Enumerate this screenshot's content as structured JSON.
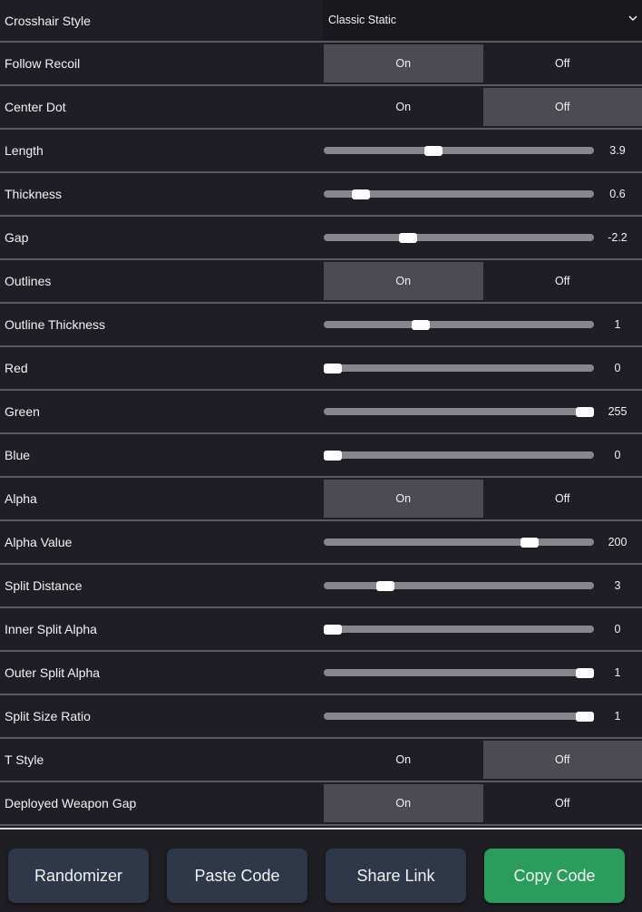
{
  "settings": [
    {
      "label": "Crosshair Style",
      "type": "select",
      "value": "Classic Static"
    },
    {
      "label": "Follow Recoil",
      "type": "toggle",
      "on_label": "On",
      "off_label": "Off",
      "value": "On"
    },
    {
      "label": "Center Dot",
      "type": "toggle",
      "on_label": "On",
      "off_label": "Off",
      "value": "Off"
    },
    {
      "label": "Length",
      "type": "slider",
      "value": "3.9",
      "fraction": 0.4
    },
    {
      "label": "Thickness",
      "type": "slider",
      "value": "0.6",
      "fraction": 0.11
    },
    {
      "label": "Gap",
      "type": "slider",
      "value": "-2.2",
      "fraction": 0.3
    },
    {
      "label": "Outlines",
      "type": "toggle",
      "on_label": "On",
      "off_label": "Off",
      "value": "On"
    },
    {
      "label": "Outline Thickness",
      "type": "slider",
      "value": "1",
      "fraction": 0.35
    },
    {
      "label": "Red",
      "type": "slider",
      "value": "0",
      "fraction": 0.0
    },
    {
      "label": "Green",
      "type": "slider",
      "value": "255",
      "fraction": 1.0
    },
    {
      "label": "Blue",
      "type": "slider",
      "value": "0",
      "fraction": 0.0
    },
    {
      "label": "Alpha",
      "type": "toggle",
      "on_label": "On",
      "off_label": "Off",
      "value": "On"
    },
    {
      "label": "Alpha Value",
      "type": "slider",
      "value": "200",
      "fraction": 0.78
    },
    {
      "label": "Split Distance",
      "type": "slider",
      "value": "3",
      "fraction": 0.21
    },
    {
      "label": "Inner Split Alpha",
      "type": "slider",
      "value": "0",
      "fraction": 0.0
    },
    {
      "label": "Outer Split Alpha",
      "type": "slider",
      "value": "1",
      "fraction": 1.0
    },
    {
      "label": "Split Size Ratio",
      "type": "slider",
      "value": "1",
      "fraction": 1.0
    },
    {
      "label": "T Style",
      "type": "toggle",
      "on_label": "On",
      "off_label": "Off",
      "value": "Off"
    },
    {
      "label": "Deployed Weapon Gap",
      "type": "toggle",
      "on_label": "On",
      "off_label": "Off",
      "value": "On"
    }
  ],
  "buttons": [
    {
      "label": "Randomizer",
      "color": "#2e3849"
    },
    {
      "label": "Paste Code",
      "color": "#2e3849"
    },
    {
      "label": "Share Link",
      "color": "#2e3849"
    },
    {
      "label": "Copy Code",
      "color": "#2a9d5c"
    }
  ]
}
